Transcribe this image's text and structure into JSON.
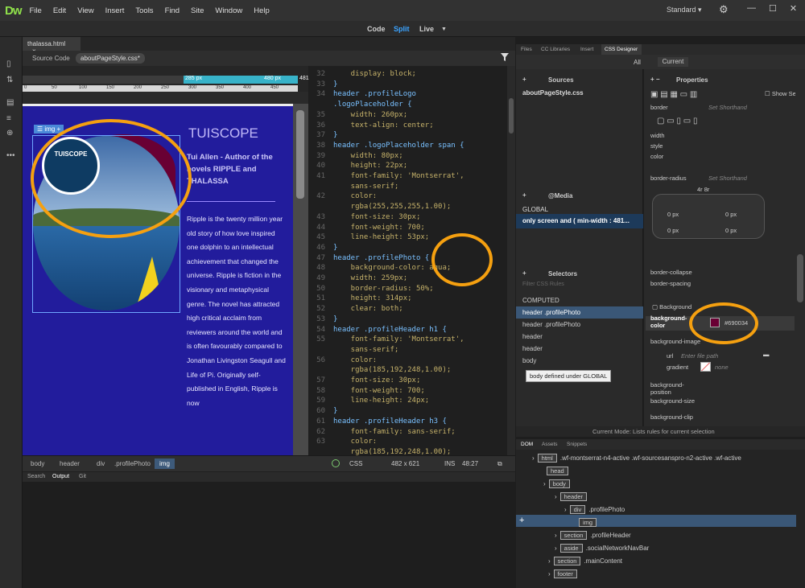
{
  "app": {
    "logo": "Dw",
    "workspace": "Standard ▾"
  },
  "menu": [
    "File",
    "Edit",
    "View",
    "Insert",
    "Tools",
    "Find",
    "Site",
    "Window",
    "Help"
  ],
  "view_modes": {
    "code": "Code",
    "split": "Split",
    "live": "Live"
  },
  "document": {
    "tab": "thalassa.html",
    "source_code": "Source Code",
    "related_file": "aboutPageStyle.css*",
    "media_bar": {
      "left": "285  px",
      "right": "480  px",
      "edge": "481"
    }
  },
  "live_view": {
    "img_tag": "img",
    "badge_text": "TUISCOPE",
    "site_title": "TUISCOPE",
    "author": "Tui Allen - Author of the novels RIPPLE and THALASSA",
    "blurb": "Ripple is the twenty million year old story of how love inspired one dolphin to an intellectual achievement that changed the universe. Ripple is fiction in the visionary and metaphysical genre. The novel has attracted high critical acclaim from reviewers around the world and is often favourably compared to Jonathan Livingston Seagull and Life of Pi. Originally self-published in English, Ripple is now"
  },
  "code_lines": [
    {
      "n": "32",
      "t": "    display: block;",
      "c": "prop"
    },
    {
      "n": "33",
      "t": "}",
      "c": "sel"
    },
    {
      "n": "34",
      "t": "header .profileLogo",
      "c": "sel"
    },
    {
      "n": "",
      "t": ".logoPlaceholder {",
      "c": "sel"
    },
    {
      "n": "35",
      "t": "    width: 260px;",
      "c": "prop"
    },
    {
      "n": "36",
      "t": "    text-align: center;",
      "c": "prop"
    },
    {
      "n": "37",
      "t": "}",
      "c": "sel"
    },
    {
      "n": "38",
      "t": "header .logoPlaceholder span {",
      "c": "sel"
    },
    {
      "n": "39",
      "t": "    width: 80px;",
      "c": "prop"
    },
    {
      "n": "40",
      "t": "    height: 22px;",
      "c": "prop"
    },
    {
      "n": "41",
      "t": "    font-family: 'Montserrat',",
      "c": "prop"
    },
    {
      "n": "",
      "t": "    sans-serif;",
      "c": "prop"
    },
    {
      "n": "42",
      "t": "    color:",
      "c": "prop"
    },
    {
      "n": "",
      "t": "    rgba(255,255,255,1.00);",
      "c": "prop"
    },
    {
      "n": "43",
      "t": "    font-size: 30px;",
      "c": "prop"
    },
    {
      "n": "44",
      "t": "    font-weight: 700;",
      "c": "prop"
    },
    {
      "n": "45",
      "t": "    line-height: 53px;",
      "c": "prop"
    },
    {
      "n": "46",
      "t": "}",
      "c": "sel"
    },
    {
      "n": "47",
      "t": "header .profilePhoto {",
      "c": "sel"
    },
    {
      "n": "48",
      "t": "    background-color: aqua;",
      "c": "prop"
    },
    {
      "n": "49",
      "t": "    width: 259px;",
      "c": "prop"
    },
    {
      "n": "50",
      "t": "    border-radius: 50%;",
      "c": "prop"
    },
    {
      "n": "51",
      "t": "    height: 314px;",
      "c": "prop"
    },
    {
      "n": "52",
      "t": "    clear: both;",
      "c": "prop"
    },
    {
      "n": "53",
      "t": "}",
      "c": "sel"
    },
    {
      "n": "54",
      "t": "header .profileHeader h1 {",
      "c": "sel"
    },
    {
      "n": "55",
      "t": "    font-family: 'Montserrat',",
      "c": "prop"
    },
    {
      "n": "",
      "t": "    sans-serif;",
      "c": "prop"
    },
    {
      "n": "56",
      "t": "    color:",
      "c": "prop"
    },
    {
      "n": "",
      "t": "    rgba(185,192,248,1.00);",
      "c": "prop"
    },
    {
      "n": "57",
      "t": "    font-size: 30px;",
      "c": "prop"
    },
    {
      "n": "58",
      "t": "    font-weight: 700;",
      "c": "prop"
    },
    {
      "n": "59",
      "t": "    line-height: 24px;",
      "c": "prop"
    },
    {
      "n": "60",
      "t": "}",
      "c": "sel"
    },
    {
      "n": "61",
      "t": "header .profileHeader h3 {",
      "c": "sel"
    },
    {
      "n": "62",
      "t": "    font-family: sans-serif;",
      "c": "prop"
    },
    {
      "n": "63",
      "t": "    color:",
      "c": "prop"
    },
    {
      "n": "",
      "t": "    rgba(185,192,248,1.00);",
      "c": "prop"
    }
  ],
  "status_bar": {
    "crumbs": [
      "body",
      "header",
      "div",
      ".profilePhoto",
      "img"
    ],
    "lang": "CSS",
    "size": "482 x 621",
    "mode": "INS",
    "position": "48:27"
  },
  "output_tabs": [
    "Search",
    "Output",
    "Git"
  ],
  "right_tabs": [
    "Files",
    "CC Libraries",
    "Insert",
    "CSS Designer"
  ],
  "css_designer": {
    "all": "All",
    "current": "Current",
    "sources_header": "Sources",
    "source_item": "aboutPageStyle.css",
    "media_header": "@Media",
    "media_items": [
      "GLOBAL",
      "only screen and ( min-width : 481..."
    ],
    "selectors_header": "Selectors",
    "filter_placeholder": "Filter CSS Rules",
    "selectors": [
      "COMPUTED",
      "header .profilePhoto",
      "header .profilePhoto",
      "header",
      "header",
      "body"
    ],
    "tooltip": "body defined under GLOBAL",
    "properties_header": "Properties",
    "show_set": "Show Set",
    "border": "border",
    "set_shorthand": "Set Shorthand",
    "width": "width",
    "style": "style",
    "color": "color",
    "border_radius": "border-radius",
    "radius_val": "4r  8r",
    "zero_px": "0 px",
    "border_collapse": "border-collapse",
    "border_spacing": "border-spacing",
    "background_section": "Background",
    "bg_color_label": "background-color",
    "bg_color_value": "#690034",
    "bg_image": "background-image",
    "url": "url",
    "url_placeholder": "Enter file path",
    "gradient": "gradient",
    "gradient_value": "none",
    "bg_position": "background-position",
    "bg_size": "background-size",
    "bg_clip": "background-clip",
    "current_mode": "Current Mode: Lists rules for current selection"
  },
  "dom_tabs": [
    "DOM",
    "Assets",
    "Snippets"
  ],
  "dom_tree": [
    {
      "tag": "html",
      "attr": ".wf-montserrat-n4-active .wf-sourcesanspro-n2-active .wf-active"
    },
    {
      "tag": "head",
      "attr": ""
    },
    {
      "tag": "body",
      "attr": ""
    },
    {
      "tag": "header",
      "attr": ""
    },
    {
      "tag": "div",
      "attr": ".profilePhoto"
    },
    {
      "tag": "img",
      "attr": ""
    },
    {
      "tag": "section",
      "attr": ".profileHeader"
    },
    {
      "tag": "aside",
      "attr": ".socialNetworkNavBar"
    },
    {
      "tag": "section",
      "attr": ".mainContent"
    },
    {
      "tag": "footer",
      "attr": ""
    }
  ],
  "colors": {
    "accent": "#38b3c9",
    "swatch": "#690034",
    "annotation": "#f5a010"
  }
}
